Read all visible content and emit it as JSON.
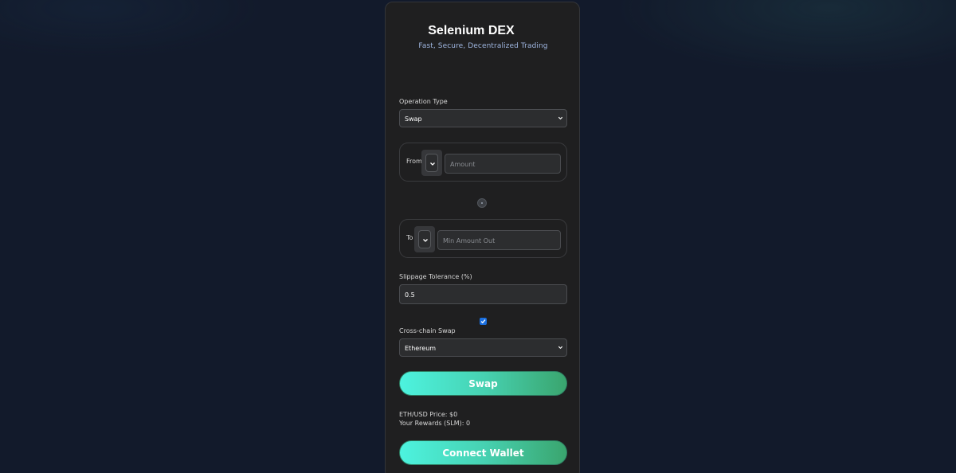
{
  "header": {
    "title": "Selenium DEX",
    "subtitle": "Fast, Secure, Decentralized Trading"
  },
  "operation": {
    "label": "Operation Type",
    "selected": "Swap"
  },
  "from": {
    "label": "From",
    "amount_placeholder": "Amount"
  },
  "to": {
    "label": "To",
    "amount_placeholder": "Min Amount Out"
  },
  "slippage": {
    "label": "Slippage Tolerance (%)",
    "value": "0.5"
  },
  "cross_chain": {
    "checked": true,
    "label": "Cross-chain Swap",
    "selected": "Ethereum"
  },
  "actions": {
    "swap_label": "Swap",
    "connect_label": "Connect Wallet"
  },
  "info": {
    "eth_price": "ETH/USD Price: $0",
    "rewards": "Your Rewards (SLM): 0"
  },
  "colors": {
    "background": "#121a2b",
    "card": "#1f1f20",
    "accent_start": "#4df3df",
    "accent_end": "#3aa56e",
    "subtitle": "#9fb6e0",
    "checkbox": "#1a6fe0"
  }
}
